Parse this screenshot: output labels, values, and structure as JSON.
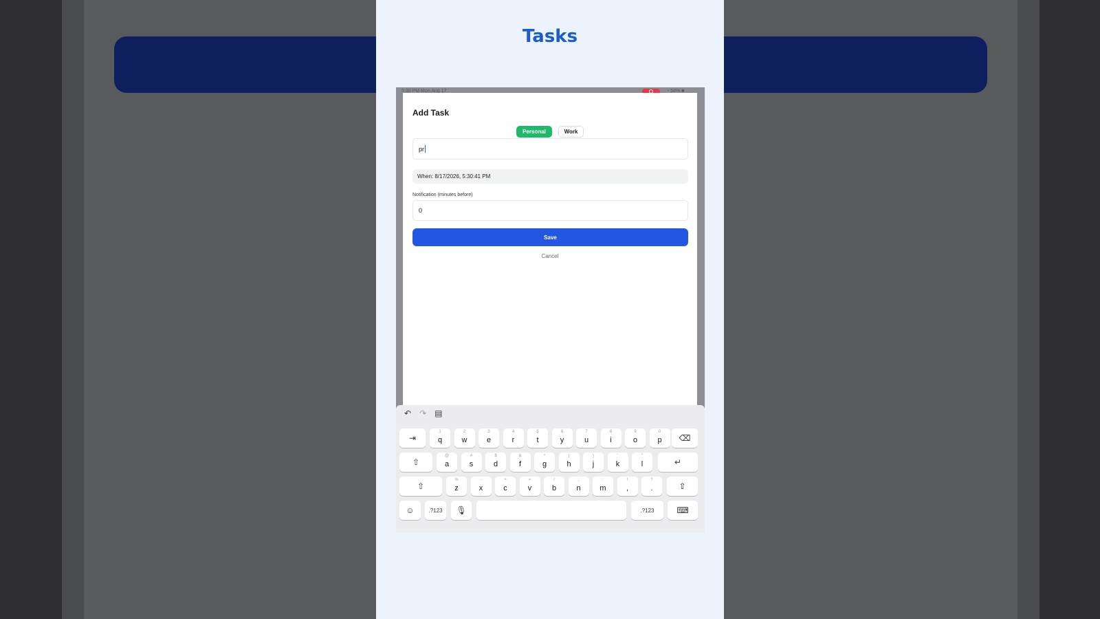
{
  "app": {
    "title": "Tasks"
  },
  "status_bar": {
    "time": "5:30 PM  Mon Aug 17",
    "battery": "58%"
  },
  "sheet": {
    "title": "Add Task",
    "segments": [
      {
        "label": "Personal",
        "selected": true
      },
      {
        "label": "Work",
        "selected": false
      }
    ],
    "title_input_value": "pr",
    "when": "When: 8/17/2026, 5:30:41 PM",
    "notification_label": "Notification (minutes before)",
    "notification_value": "0",
    "save_label": "Save",
    "cancel_label": "Cancel"
  },
  "keyboard": {
    "row1": [
      {
        "k": "q",
        "h": "1"
      },
      {
        "k": "w",
        "h": "2"
      },
      {
        "k": "e",
        "h": "3"
      },
      {
        "k": "r",
        "h": "4"
      },
      {
        "k": "t",
        "h": "5"
      },
      {
        "k": "y",
        "h": "6"
      },
      {
        "k": "u",
        "h": "7"
      },
      {
        "k": "i",
        "h": "8"
      },
      {
        "k": "o",
        "h": "9"
      },
      {
        "k": "p",
        "h": "0"
      }
    ],
    "row2": [
      {
        "k": "a",
        "h": "@"
      },
      {
        "k": "s",
        "h": "#"
      },
      {
        "k": "d",
        "h": "$"
      },
      {
        "k": "f",
        "h": "&"
      },
      {
        "k": "g",
        "h": "*"
      },
      {
        "k": "h",
        "h": "("
      },
      {
        "k": "j",
        "h": ")"
      },
      {
        "k": "k",
        "h": "'"
      },
      {
        "k": "l",
        "h": "\""
      }
    ],
    "row3": [
      {
        "k": "z",
        "h": "%"
      },
      {
        "k": "x",
        "h": "-"
      },
      {
        "k": "c",
        "h": "+"
      },
      {
        "k": "v",
        "h": "="
      },
      {
        "k": "b",
        "h": "/"
      },
      {
        "k": "n",
        "h": ";"
      },
      {
        "k": "m",
        "h": ":"
      },
      {
        "k": ",",
        "h": "!"
      },
      {
        "k": ".",
        "h": "?"
      }
    ],
    "num_label": ".?123",
    "icons": {
      "undo": "undo-icon",
      "redo": "redo-icon",
      "paste": "paste-icon",
      "tab": "tab-icon",
      "delete": "delete-icon",
      "shift": "shift-icon",
      "return": "return-icon",
      "emoji": "emoji-icon",
      "mic": "microphone-icon",
      "dismiss": "keyboard-dismiss-icon"
    },
    "accent_color": "#2457e1"
  }
}
